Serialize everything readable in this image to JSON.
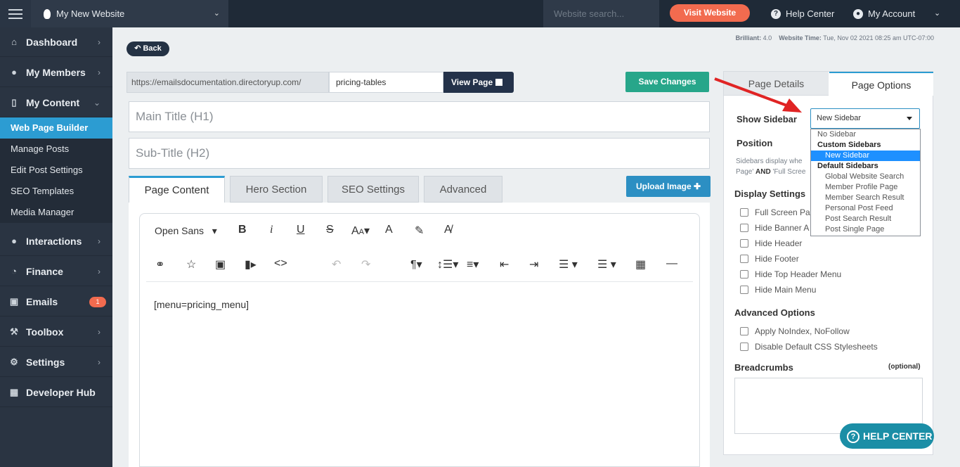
{
  "topbar": {
    "site_name": "My New Website",
    "search_placeholder": "Website search...",
    "visit_label": "Visit Website",
    "help_label": "Help Center",
    "account_label": "My Account"
  },
  "sidebar": {
    "items": [
      {
        "label": "Dashboard"
      },
      {
        "label": "My Members"
      },
      {
        "label": "My Content"
      },
      {
        "label": "Interactions"
      },
      {
        "label": "Finance"
      },
      {
        "label": "Emails",
        "badge": "1"
      },
      {
        "label": "Toolbox"
      },
      {
        "label": "Settings"
      },
      {
        "label": "Developer Hub"
      }
    ],
    "content_sub": [
      "Web Page Builder",
      "Manage Posts",
      "Edit Post Settings",
      "SEO Templates",
      "Media Manager"
    ]
  },
  "main": {
    "back_label": "Back",
    "meta_version_label": "Brilliant:",
    "meta_version": "4.0",
    "meta_time_label": "Website Time:",
    "meta_time": "Tue, Nov 02 2021 08:25 am UTC-07:00",
    "url_prefix": "https://emailsdocumentation.directoryup.com/",
    "url_slug": "pricing-tables",
    "view_page_label": "View Page",
    "save_label": "Save Changes",
    "h1_placeholder": "Main Title (H1)",
    "h2_placeholder": "Sub-Title (H2)",
    "tabs": [
      "Page Content",
      "Hero Section",
      "SEO Settings",
      "Advanced"
    ],
    "upload_label": "Upload Image",
    "editor": {
      "font": "Open Sans",
      "content": "[menu=pricing_menu]"
    }
  },
  "panel": {
    "tabs": [
      "Page Details",
      "Page Options"
    ],
    "show_sidebar_label": "Show Sidebar",
    "sidebar_selected": "New Sidebar",
    "position_label": "Position",
    "sidebar_options": [
      {
        "label": "No Sidebar"
      },
      {
        "label": "Custom Sidebars"
      },
      {
        "label": "New Sidebar"
      },
      {
        "label": "Default Sidebars"
      },
      {
        "label": "Global Website Search"
      },
      {
        "label": "Member Profile Page"
      },
      {
        "label": "Member Search Result"
      },
      {
        "label": "Personal Post Feed"
      },
      {
        "label": "Post Search Result"
      },
      {
        "label": "Post Single Page"
      }
    ],
    "sidebar_desc_1": "Sidebars display whe",
    "sidebar_desc_2a": "Page'",
    "sidebar_desc_2b": "AND",
    "sidebar_desc_2c": "'Full Scree",
    "display_settings_label": "Display Settings",
    "display_options": [
      "Full Screen Pa",
      "Hide Banner A",
      "Hide Header",
      "Hide Footer",
      "Hide Top Header Menu",
      "Hide Main Menu"
    ],
    "advanced_label": "Advanced Options",
    "advanced_options": [
      "Apply NoIndex, NoFollow",
      "Disable Default CSS Stylesheets"
    ],
    "breadcrumbs_label": "Breadcrumbs",
    "breadcrumbs_optional": "(optional)"
  },
  "help_button_label": "HELP CENTER",
  "colors": {
    "accent": "#2c9cd2",
    "save": "#27a68a",
    "visit": "#f26b4f",
    "annotation_arrow": "#e02424"
  }
}
